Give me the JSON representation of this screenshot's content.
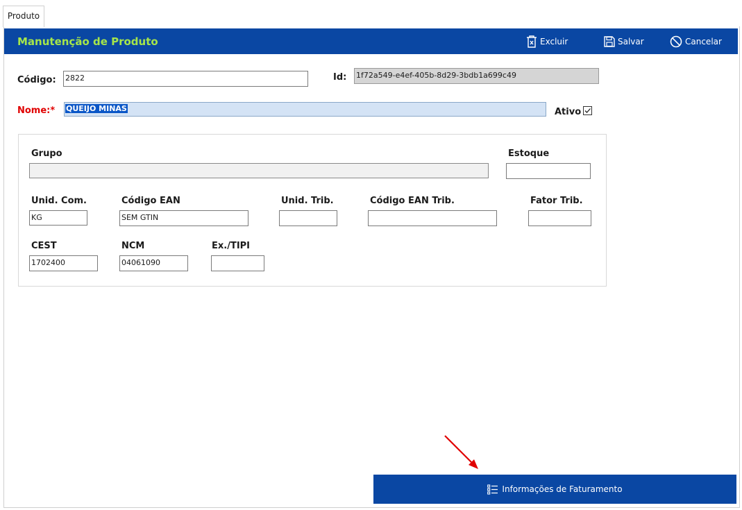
{
  "tab": {
    "label": "Produto"
  },
  "header": {
    "title": "Manutenção de Produto",
    "excluir": "Excluir",
    "salvar": "Salvar",
    "cancelar": "Cancelar"
  },
  "form": {
    "codigo": {
      "label": "Código:",
      "value": "2822"
    },
    "id": {
      "label": "Id:",
      "value": "1f72a549-e4ef-405b-8d29-3bdb1a699c49"
    },
    "nome": {
      "label": "Nome:*",
      "value": "QUEIJO MINAS"
    },
    "ativo": {
      "label": "Ativo",
      "checked": true
    },
    "grupo": {
      "label": "Grupo",
      "value": ""
    },
    "estoque": {
      "label": "Estoque",
      "value": ""
    },
    "unid_com": {
      "label": "Unid. Com.",
      "value": "KG"
    },
    "codigo_ean": {
      "label": "Código EAN",
      "value": "SEM GTIN"
    },
    "unid_trib": {
      "label": "Unid. Trib.",
      "value": ""
    },
    "codigo_ean_trib": {
      "label": "Código EAN Trib.",
      "value": ""
    },
    "fator_trib": {
      "label": "Fator Trib.",
      "value": ""
    },
    "cest": {
      "label": "CEST",
      "value": "1702400"
    },
    "ncm": {
      "label": "NCM",
      "value": "04061090"
    },
    "ex_tipi": {
      "label": "Ex./TIPI",
      "value": ""
    }
  },
  "footer": {
    "faturamento": "Informações de Faturamento"
  },
  "colors": {
    "header_bg": "#0a47a3",
    "title": "#a6e64a",
    "required": "#e00000",
    "annotation": "#e00000"
  },
  "icons": [
    "trash-icon",
    "save-icon",
    "cancel-icon",
    "check-icon",
    "list-icon",
    "arrow-annotation"
  ]
}
